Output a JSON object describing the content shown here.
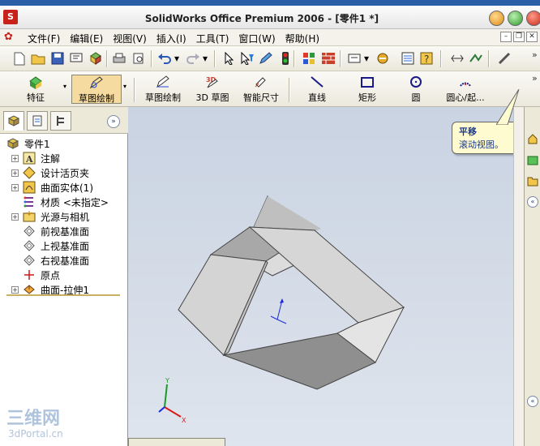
{
  "titlebar": {
    "app_icon_text": "S",
    "title": "SolidWorks Office Premium 2006 - [零件1 *]"
  },
  "menubar": {
    "items": [
      "文件(F)",
      "编辑(E)",
      "视图(V)",
      "插入(I)",
      "工具(T)",
      "窗口(W)",
      "帮助(H)"
    ]
  },
  "toolbar_standard": {
    "icons": [
      "new-icon",
      "open-icon",
      "save-icon",
      "print-preview-icon",
      "component-icon",
      "print-icon",
      "zoom-icon",
      "undo-icon",
      "redo-icon",
      "select-icon",
      "select-filter-icon",
      "edit-icon",
      "traffic-light-icon",
      "grid-icon",
      "brick-icon",
      "options-icon",
      "plugin-icon",
      "help-icon",
      "toolbox-icon",
      "motion-icon",
      "wrench-icon"
    ]
  },
  "command_manager": {
    "features_label": "特征",
    "sketch_label": "草图绘制",
    "sketch2_label": "草图绘制",
    "sketch3d_label": "3D 草图",
    "smart_dim_label": "智能尺寸",
    "line_label": "直线",
    "rect_label": "矩形",
    "circle_label": "圆",
    "arc_label": "圆心/起...",
    "more_label": "»"
  },
  "feature_tree": {
    "root": "零件1",
    "items": [
      {
        "label": "注解",
        "icon": "annotation-icon",
        "expandable": true
      },
      {
        "label": "设计活页夹",
        "icon": "design-binder-icon",
        "expandable": true
      },
      {
        "label": "曲面实体(1)",
        "icon": "surface-body-icon",
        "expandable": true
      },
      {
        "label": "材质 <未指定>",
        "icon": "material-icon",
        "expandable": false
      },
      {
        "label": "光源与相机",
        "icon": "lights-camera-icon",
        "expandable": true
      },
      {
        "label": "前视基准面",
        "icon": "plane-icon",
        "expandable": false
      },
      {
        "label": "上视基准面",
        "icon": "plane-icon",
        "expandable": false
      },
      {
        "label": "右视基准面",
        "icon": "plane-icon",
        "expandable": false
      },
      {
        "label": "原点",
        "icon": "origin-icon",
        "expandable": false
      },
      {
        "label": "曲面-拉伸1",
        "icon": "surface-extrude-icon",
        "expandable": true
      }
    ]
  },
  "tooltip": {
    "title": "平移",
    "body": "滚动视图。"
  },
  "watermark": {
    "logo": "三维网",
    "url": "3dPortal.cn"
  },
  "colors": {
    "viewport_bg": "#d0d9e6",
    "face_light": "#d4d4d4",
    "face_dark": "#8f8f8f",
    "accent_selected": "#f6dba0"
  }
}
